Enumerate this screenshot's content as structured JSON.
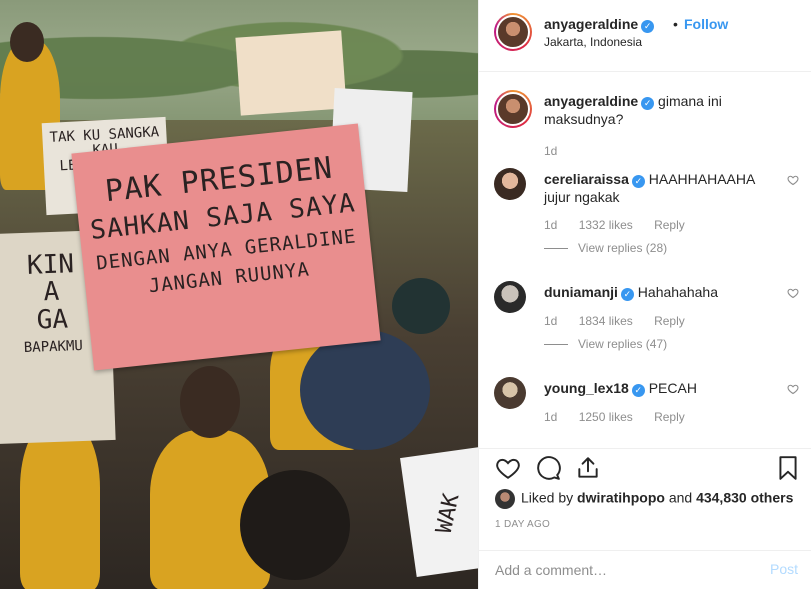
{
  "header": {
    "username": "anyageraldine",
    "separator": "•",
    "follow_label": "Follow",
    "location": "Jakarta, Indonesia"
  },
  "photo": {
    "sign_main": [
      "PAK PRESIDEN",
      "SAHKAN SAJA SAYA",
      "DENGAN ANYA GERALDINE",
      "JANGAN RUUNYA"
    ],
    "sign_left": [
      "TAK KU SANGKA",
      "KAU",
      "LEBIH SADIS"
    ],
    "sign_bottom_left": [
      "KIN",
      "A",
      "GA",
      "BAPAKMU"
    ],
    "sign_bottom_right": "WAK"
  },
  "caption": {
    "username": "anyageraldine",
    "text": "gimana ini maksudnya?",
    "time": "1d"
  },
  "comments": [
    {
      "username": "cereliaraissa",
      "text": "HAAHHAHAAHA jujur ngakak",
      "time": "1d",
      "likes": "1332 likes",
      "reply": "Reply",
      "view_replies": "View replies (28)",
      "verified": true
    },
    {
      "username": "duniamanji",
      "text": "Hahahahaha",
      "time": "1d",
      "likes": "1834 likes",
      "reply": "Reply",
      "view_replies": "View replies (47)",
      "verified": true
    },
    {
      "username": "young_lex18",
      "text": "PECAH",
      "time": "1d",
      "likes": "1250 likes",
      "reply": "Reply",
      "verified": true
    }
  ],
  "likes": {
    "prefix": "Liked by",
    "user": "dwiratihpopo",
    "and": "and",
    "others": "434,830 others"
  },
  "timestamp": "1 DAY AGO",
  "add_comment": {
    "placeholder": "Add a comment…",
    "post_label": "Post"
  }
}
